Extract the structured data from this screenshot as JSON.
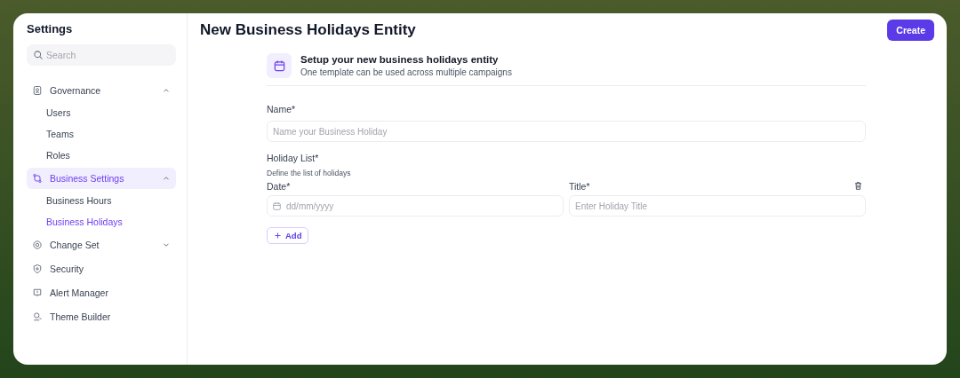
{
  "sidebar": {
    "title": "Settings",
    "search": {
      "placeholder": "Search"
    },
    "items": [
      {
        "label": "Governance",
        "expanded": true,
        "selected": false,
        "children": [
          {
            "label": "Users",
            "selected": false
          },
          {
            "label": "Teams",
            "selected": false
          },
          {
            "label": "Roles",
            "selected": false
          }
        ]
      },
      {
        "label": "Business Settings",
        "expanded": true,
        "selected": true,
        "children": [
          {
            "label": "Business Hours",
            "selected": false
          },
          {
            "label": "Business Holidays",
            "selected": true
          }
        ]
      },
      {
        "label": "Change Set",
        "expanded": false,
        "selected": false
      },
      {
        "label": "Security",
        "selected": false
      },
      {
        "label": "Alert Manager",
        "selected": false
      },
      {
        "label": "Theme Builder",
        "selected": false
      }
    ]
  },
  "page": {
    "title": "New Business Holidays Entity",
    "create_button": "Create"
  },
  "form": {
    "heading": "Setup your new business holidays entity",
    "subheading": "One template can be used across multiple campaigns",
    "name_label": "Name*",
    "name_placeholder": "Name your Business Holiday",
    "list_label": "Holiday List*",
    "list_hint": "Define the list of holidays",
    "date_label": "Date*",
    "date_placeholder": "dd/mm/yyyy",
    "title_label": "Title*",
    "title_placeholder": "Enter Holiday Title",
    "add_button": "Add"
  }
}
